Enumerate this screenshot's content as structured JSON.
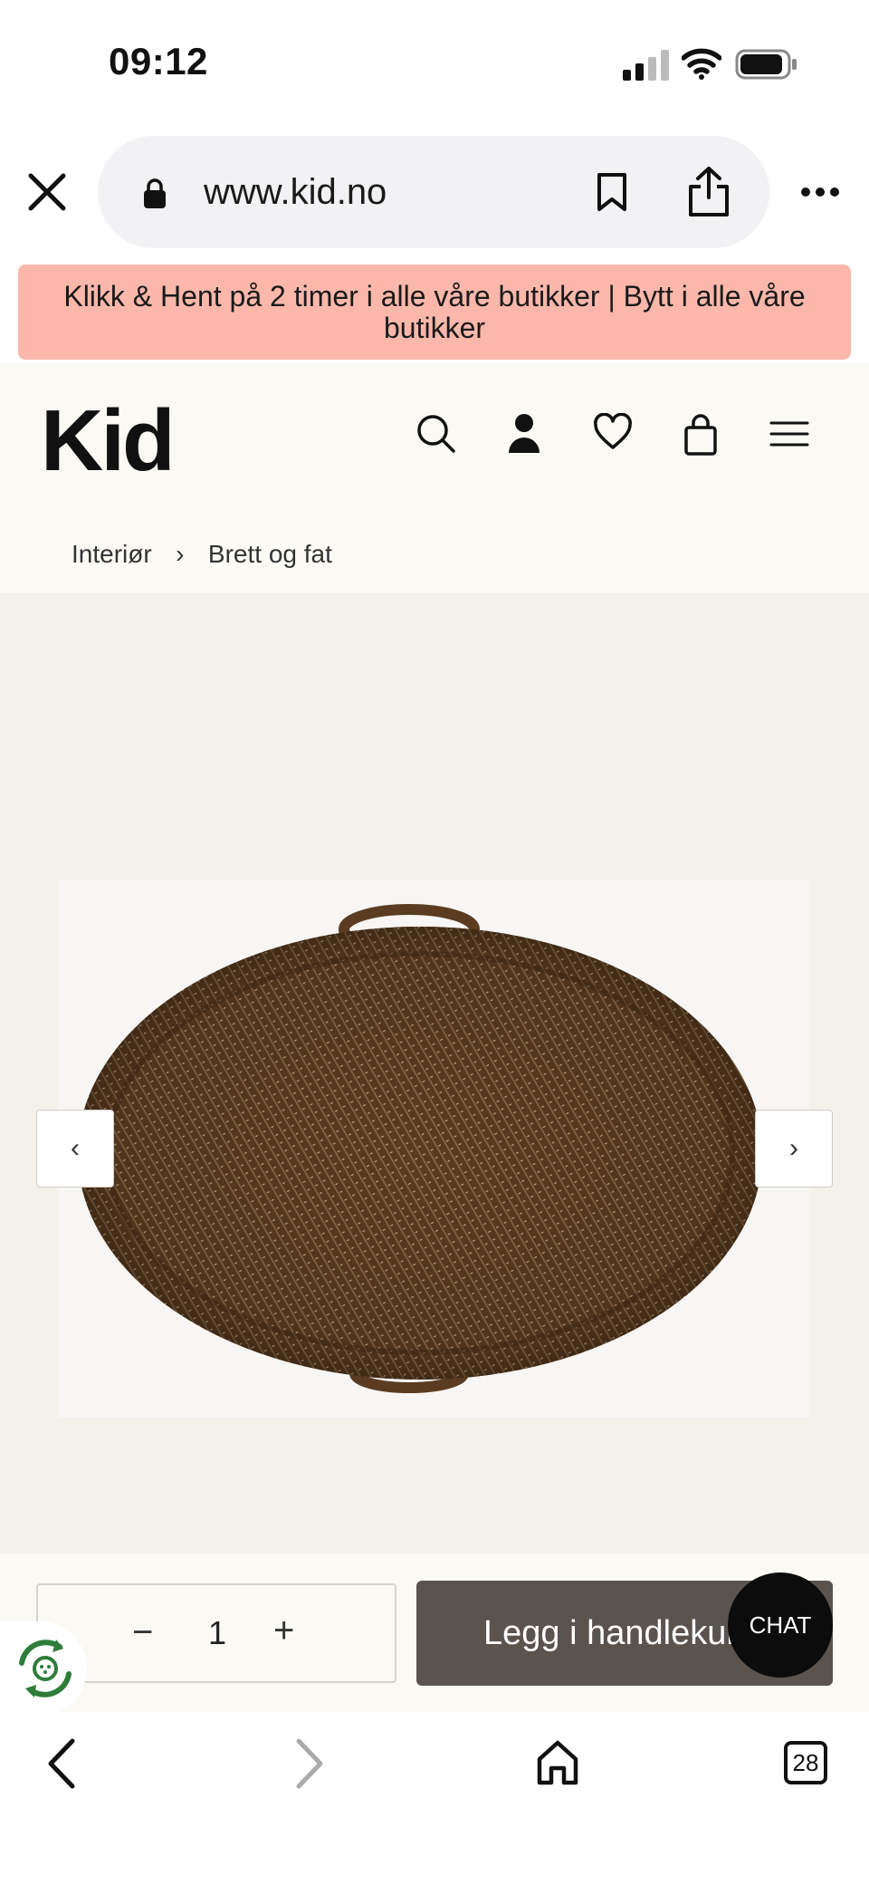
{
  "status_bar": {
    "time": "09:12"
  },
  "browser": {
    "url": "www.kid.no",
    "tab_count": "28"
  },
  "promo": {
    "text": "Klikk & Hent på 2 timer i alle våre butikker | Bytt i alle våre butikker"
  },
  "header": {
    "logo": "Kid"
  },
  "breadcrumb": {
    "items": [
      "Interiør",
      "Brett og fat"
    ],
    "separator": "›"
  },
  "carousel": {
    "prev": "‹",
    "next": "›"
  },
  "cart": {
    "quantity": "1",
    "minus": "−",
    "plus": "+",
    "add_label": "Legg i handlekurv"
  },
  "chat": {
    "label": "CHAT"
  },
  "colors": {
    "promo_bg": "#fbb7aa",
    "add_button": "#5b534e",
    "eco_green": "#2e7d3a"
  }
}
